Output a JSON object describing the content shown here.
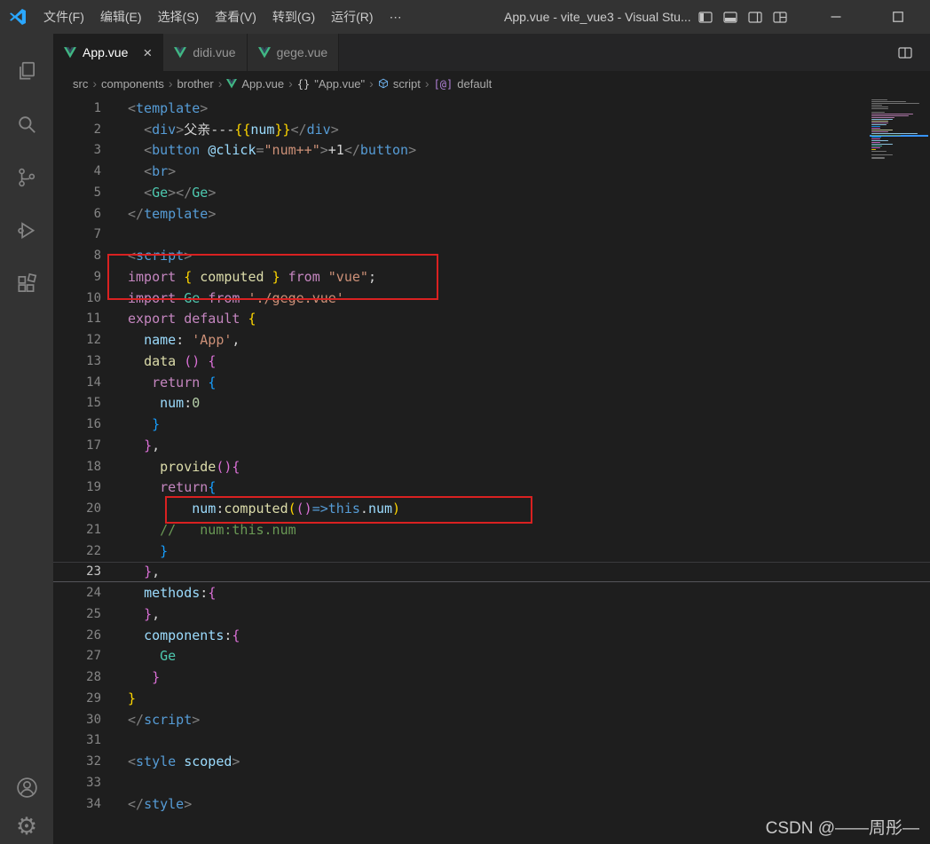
{
  "titlebar": {
    "title": "App.vue - vite_vue3 - Visual Stu...",
    "menus": [
      "文件(F)",
      "编辑(E)",
      "选择(S)",
      "查看(V)",
      "转到(G)",
      "运行(R)",
      "⋯"
    ],
    "window_icons": [
      "toggle-sidebar",
      "toggle-panel",
      "toggle-secondary-sidebar",
      "customize-layout",
      "minimize",
      "maximize"
    ]
  },
  "activity_bar": {
    "icons": [
      "explorer",
      "search",
      "source-control",
      "run-debug",
      "extensions"
    ],
    "bottom_icons": [
      "account",
      "settings"
    ]
  },
  "tabs": [
    {
      "label": "App.vue",
      "active": true
    },
    {
      "label": "didi.vue",
      "active": false
    },
    {
      "label": "gege.vue",
      "active": false
    }
  ],
  "tabbar_actions": [
    "split-editor"
  ],
  "breadcrumb": {
    "items": [
      {
        "label": "src",
        "icon": ""
      },
      {
        "label": "components",
        "icon": ""
      },
      {
        "label": "brother",
        "icon": ""
      },
      {
        "label": "App.vue",
        "icon": "vue-icon"
      },
      {
        "label": "\"App.vue\"",
        "icon": "braces-icon"
      },
      {
        "label": "script",
        "icon": "module-icon"
      },
      {
        "label": "default",
        "icon": "symbol-default-icon"
      }
    ]
  },
  "editor": {
    "current_line": 23,
    "lines": [
      {
        "n": 1,
        "tokens": [
          [
            "punct",
            "<"
          ],
          [
            "tag",
            "template"
          ],
          [
            "punct",
            ">"
          ]
        ]
      },
      {
        "n": 2,
        "tokens": [
          [
            "plain",
            "  "
          ],
          [
            "punct",
            "<"
          ],
          [
            "tag",
            "div"
          ],
          [
            "punct",
            ">"
          ],
          [
            "plain",
            "父亲---"
          ],
          [
            "b1",
            "{{"
          ],
          [
            "prop",
            "num"
          ],
          [
            "b1",
            "}}"
          ],
          [
            "punct",
            "</"
          ],
          [
            "tag",
            "div"
          ],
          [
            "punct",
            ">"
          ]
        ]
      },
      {
        "n": 3,
        "tokens": [
          [
            "plain",
            "  "
          ],
          [
            "punct",
            "<"
          ],
          [
            "tag",
            "button"
          ],
          [
            "plain",
            " "
          ],
          [
            "attr",
            "@click"
          ],
          [
            "punct",
            "="
          ],
          [
            "str",
            "\"num++\""
          ],
          [
            "punct",
            ">"
          ],
          [
            "plain",
            "+1"
          ],
          [
            "punct",
            "</"
          ],
          [
            "tag",
            "button"
          ],
          [
            "punct",
            ">"
          ]
        ]
      },
      {
        "n": 4,
        "tokens": [
          [
            "plain",
            "  "
          ],
          [
            "punct",
            "<"
          ],
          [
            "tag",
            "br"
          ],
          [
            "punct",
            ">"
          ]
        ]
      },
      {
        "n": 5,
        "tokens": [
          [
            "plain",
            "  "
          ],
          [
            "punct",
            "<"
          ],
          [
            "comp",
            "Ge"
          ],
          [
            "punct",
            "></"
          ],
          [
            "comp",
            "Ge"
          ],
          [
            "punct",
            ">"
          ]
        ]
      },
      {
        "n": 6,
        "tokens": [
          [
            "punct",
            "</"
          ],
          [
            "tag",
            "template"
          ],
          [
            "punct",
            ">"
          ]
        ]
      },
      {
        "n": 7,
        "tokens": []
      },
      {
        "n": 8,
        "tokens": [
          [
            "punct",
            "<"
          ],
          [
            "tag",
            "script"
          ],
          [
            "punct",
            ">"
          ]
        ]
      },
      {
        "n": 9,
        "tokens": [
          [
            "kw",
            "import"
          ],
          [
            "plain",
            " "
          ],
          [
            "b1",
            "{"
          ],
          [
            "plain",
            " "
          ],
          [
            "fn",
            "computed"
          ],
          [
            "plain",
            " "
          ],
          [
            "b1",
            "}"
          ],
          [
            "plain",
            " "
          ],
          [
            "kw",
            "from"
          ],
          [
            "plain",
            " "
          ],
          [
            "str",
            "\"vue\""
          ],
          [
            "plain",
            ";"
          ]
        ]
      },
      {
        "n": 10,
        "tokens": [
          [
            "kw",
            "import"
          ],
          [
            "plain",
            " "
          ],
          [
            "comp",
            "Ge"
          ],
          [
            "plain",
            " "
          ],
          [
            "kw",
            "from"
          ],
          [
            "plain",
            " "
          ],
          [
            "str",
            "'./gege.vue'"
          ]
        ]
      },
      {
        "n": 11,
        "tokens": [
          [
            "kw",
            "export"
          ],
          [
            "plain",
            " "
          ],
          [
            "kw",
            "default"
          ],
          [
            "plain",
            " "
          ],
          [
            "b1",
            "{"
          ]
        ]
      },
      {
        "n": 12,
        "tokens": [
          [
            "plain",
            "  "
          ],
          [
            "prop",
            "name"
          ],
          [
            "plain",
            ": "
          ],
          [
            "str",
            "'App'"
          ],
          [
            "plain",
            ","
          ]
        ]
      },
      {
        "n": 13,
        "tokens": [
          [
            "plain",
            "  "
          ],
          [
            "fn",
            "data"
          ],
          [
            "plain",
            " "
          ],
          [
            "b2",
            "()"
          ],
          [
            "plain",
            " "
          ],
          [
            "b2",
            "{"
          ]
        ]
      },
      {
        "n": 14,
        "tokens": [
          [
            "plain",
            "   "
          ],
          [
            "kw",
            "return"
          ],
          [
            "plain",
            " "
          ],
          [
            "b3",
            "{"
          ]
        ]
      },
      {
        "n": 15,
        "tokens": [
          [
            "plain",
            "    "
          ],
          [
            "prop",
            "num"
          ],
          [
            "plain",
            ":"
          ],
          [
            "num",
            "0"
          ]
        ]
      },
      {
        "n": 16,
        "tokens": [
          [
            "plain",
            "   "
          ],
          [
            "b3",
            "}"
          ]
        ]
      },
      {
        "n": 17,
        "tokens": [
          [
            "plain",
            "  "
          ],
          [
            "b2",
            "}"
          ],
          [
            "plain",
            ","
          ]
        ]
      },
      {
        "n": 18,
        "tokens": [
          [
            "plain",
            "    "
          ],
          [
            "fn",
            "provide"
          ],
          [
            "b2",
            "(){"
          ]
        ]
      },
      {
        "n": 19,
        "tokens": [
          [
            "plain",
            "    "
          ],
          [
            "kw",
            "return"
          ],
          [
            "b3",
            "{"
          ]
        ]
      },
      {
        "n": 20,
        "tokens": [
          [
            "plain",
            "        "
          ],
          [
            "prop",
            "num"
          ],
          [
            "plain",
            ":"
          ],
          [
            "fn",
            "computed"
          ],
          [
            "b1",
            "("
          ],
          [
            "b2",
            "()"
          ],
          [
            "kwb",
            "=>"
          ],
          [
            "kwb",
            "this"
          ],
          [
            "plain",
            "."
          ],
          [
            "prop",
            "num"
          ],
          [
            "b1",
            ")"
          ]
        ]
      },
      {
        "n": 21,
        "tokens": [
          [
            "plain",
            "    "
          ],
          [
            "cmt",
            "//   num:this.num"
          ]
        ]
      },
      {
        "n": 22,
        "tokens": [
          [
            "plain",
            "    "
          ],
          [
            "b3",
            "}"
          ]
        ]
      },
      {
        "n": 23,
        "tokens": [
          [
            "plain",
            "  "
          ],
          [
            "b2",
            "}"
          ],
          [
            "plain",
            ","
          ]
        ]
      },
      {
        "n": 24,
        "tokens": [
          [
            "plain",
            "  "
          ],
          [
            "prop",
            "methods"
          ],
          [
            "plain",
            ":"
          ],
          [
            "b2",
            "{"
          ]
        ]
      },
      {
        "n": 25,
        "tokens": [
          [
            "plain",
            "  "
          ],
          [
            "b2",
            "}"
          ],
          [
            "plain",
            ","
          ]
        ]
      },
      {
        "n": 26,
        "tokens": [
          [
            "plain",
            "  "
          ],
          [
            "prop",
            "components"
          ],
          [
            "plain",
            ":"
          ],
          [
            "b2",
            "{"
          ]
        ]
      },
      {
        "n": 27,
        "tokens": [
          [
            "plain",
            "    "
          ],
          [
            "comp",
            "Ge"
          ]
        ]
      },
      {
        "n": 28,
        "tokens": [
          [
            "plain",
            "   "
          ],
          [
            "b2",
            "}"
          ]
        ]
      },
      {
        "n": 29,
        "tokens": [
          [
            "b1",
            "}"
          ]
        ]
      },
      {
        "n": 30,
        "tokens": [
          [
            "punct",
            "</"
          ],
          [
            "tag",
            "script"
          ],
          [
            "punct",
            ">"
          ]
        ]
      },
      {
        "n": 31,
        "tokens": []
      },
      {
        "n": 32,
        "tokens": [
          [
            "punct",
            "<"
          ],
          [
            "tag",
            "style"
          ],
          [
            "plain",
            " "
          ],
          [
            "attr",
            "scoped"
          ],
          [
            "punct",
            ">"
          ]
        ]
      },
      {
        "n": 33,
        "tokens": []
      },
      {
        "n": 34,
        "tokens": [
          [
            "punct",
            "</"
          ],
          [
            "tag",
            "style"
          ],
          [
            "punct",
            ">"
          ]
        ]
      }
    ]
  },
  "annotations": [
    {
      "name": "red-box-import-computed",
      "lines": "8-10"
    },
    {
      "name": "red-box-provide-computed",
      "lines": "20"
    }
  ],
  "watermark": "CSDN @——周彤—",
  "colors": {
    "red_annotation": "#d92121",
    "vue_green": "#41b883",
    "editor_bg": "#1e1e1e",
    "chrome_bg": "#333333",
    "tabstrip_bg": "#252526"
  }
}
